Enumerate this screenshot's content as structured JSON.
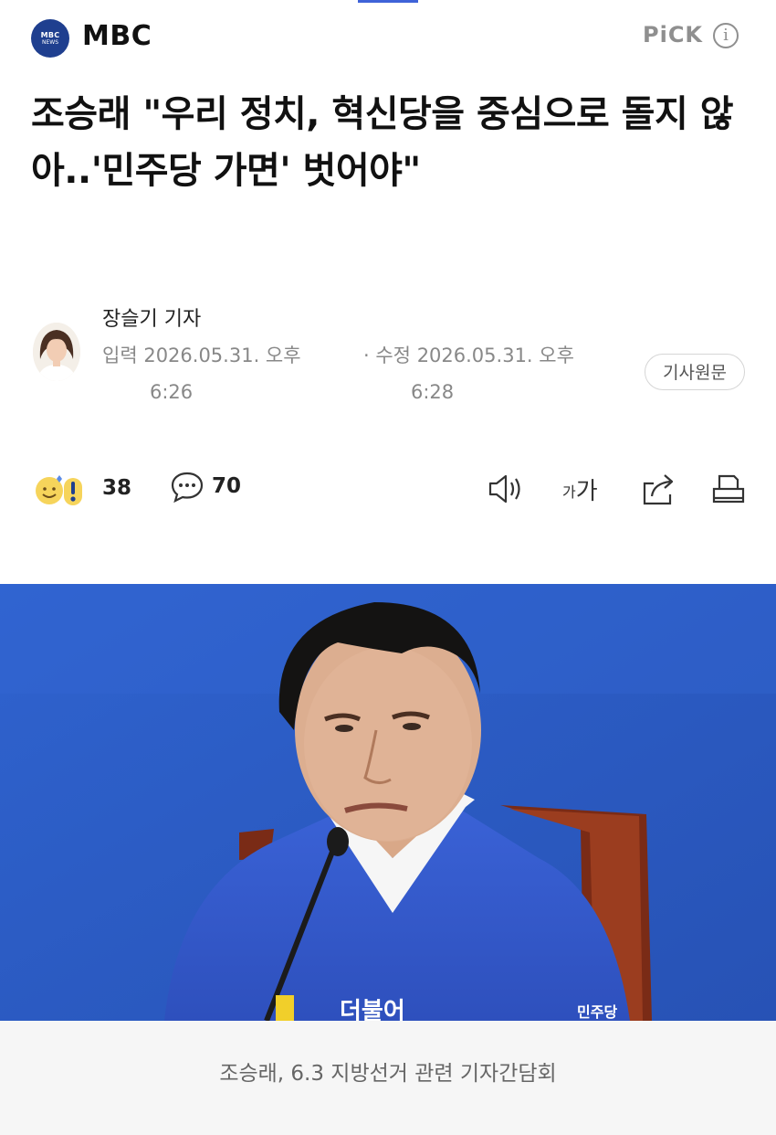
{
  "header": {
    "press_logo_line1": "MBC",
    "press_logo_line2": "NEWS",
    "press_name": "MBC",
    "pick_label": "PiCK",
    "info_icon": "info-icon"
  },
  "article": {
    "title": "조승래 \"우리 정치, 혁신당을 중심으로 돌지 않아..'민주당 가면' 벗어야\"",
    "reporter": "장슬기 기자",
    "input_label": "입력",
    "input_date": "2026.05.31. 오후",
    "input_time": "6:26",
    "edit_label": "· 수정",
    "edit_date": "2026.05.31. 오후",
    "edit_time": "6:28",
    "source_button": "기사원문"
  },
  "toolbar": {
    "reaction_count": "38",
    "comment_count": "70",
    "font_size_small": "가",
    "font_size_large": "가",
    "icons": [
      "reaction-emoji-icon",
      "comment-bubble-icon",
      "speaker-icon",
      "share-icon",
      "print-icon"
    ]
  },
  "photo": {
    "shirt_text_left": "더불어",
    "shirt_text_right": "민주당",
    "caption": "조승래, 6.3 지방선거 관련 기자간담회"
  },
  "colors": {
    "brand_blue": "#1f3f8f",
    "background_blue": "#2d5fc7",
    "muted_gray": "#888888"
  }
}
